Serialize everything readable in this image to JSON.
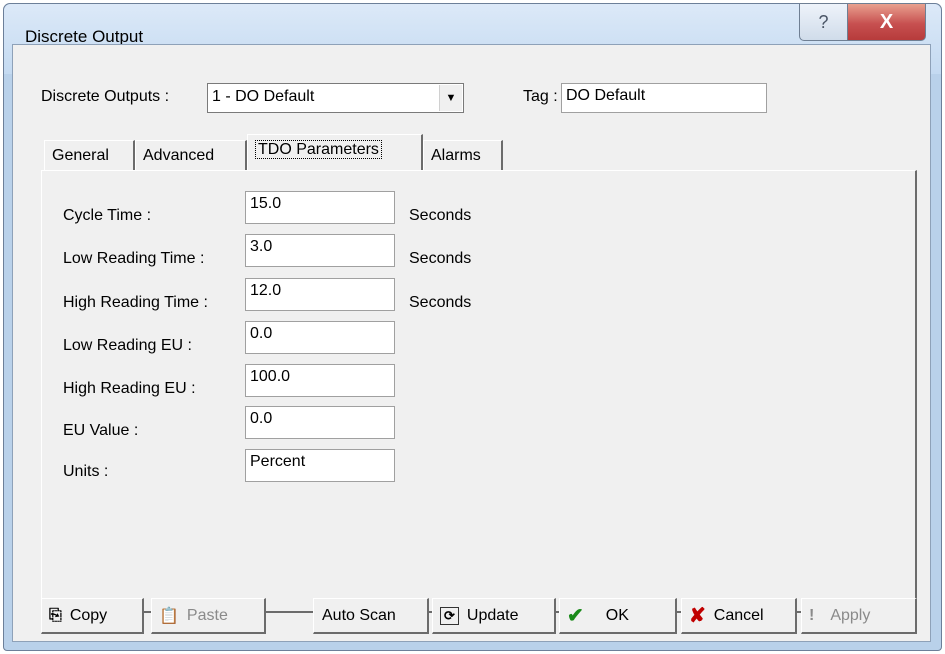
{
  "window": {
    "title": "Discrete Output",
    "help_glyph": "?",
    "close_glyph": "X"
  },
  "header": {
    "discrete_outputs_label": "Discrete Outputs :",
    "discrete_outputs_value": "1 - DO Default",
    "tag_label": "Tag :",
    "tag_value": "DO Default"
  },
  "tabs": [
    {
      "label": "General"
    },
    {
      "label": "Advanced"
    },
    {
      "label": "TDO Parameters",
      "active": true
    },
    {
      "label": "Alarms"
    }
  ],
  "fields": {
    "cycle_time": {
      "label": "Cycle Time :",
      "value": "15.0",
      "unit": "Seconds"
    },
    "low_reading_time": {
      "label": "Low Reading Time :",
      "value": "3.0",
      "unit": "Seconds"
    },
    "high_reading_time": {
      "label": "High Reading Time :",
      "value": "12.0",
      "unit": "Seconds"
    },
    "low_reading_eu": {
      "label": "Low Reading EU :",
      "value": "0.0"
    },
    "high_reading_eu": {
      "label": "High Reading EU :",
      "value": "100.0"
    },
    "eu_value": {
      "label": "EU Value :",
      "value": "0.0"
    },
    "units": {
      "label": "Units :",
      "value": "Percent"
    }
  },
  "buttons": {
    "copy": "Copy",
    "paste": "Paste",
    "auto_scan": "Auto Scan",
    "update": "Update",
    "ok": "OK",
    "cancel": "Cancel",
    "apply": "Apply"
  },
  "icons": {
    "copy": "copy-icon",
    "paste": "paste-icon",
    "update": "refresh-icon",
    "ok": "checkmark-icon",
    "cancel": "x-icon",
    "apply": "exclamation-icon"
  },
  "colors": {
    "ok_check": "#1a8a1a",
    "cancel_x": "#c00000",
    "close_button": "#c75050"
  }
}
